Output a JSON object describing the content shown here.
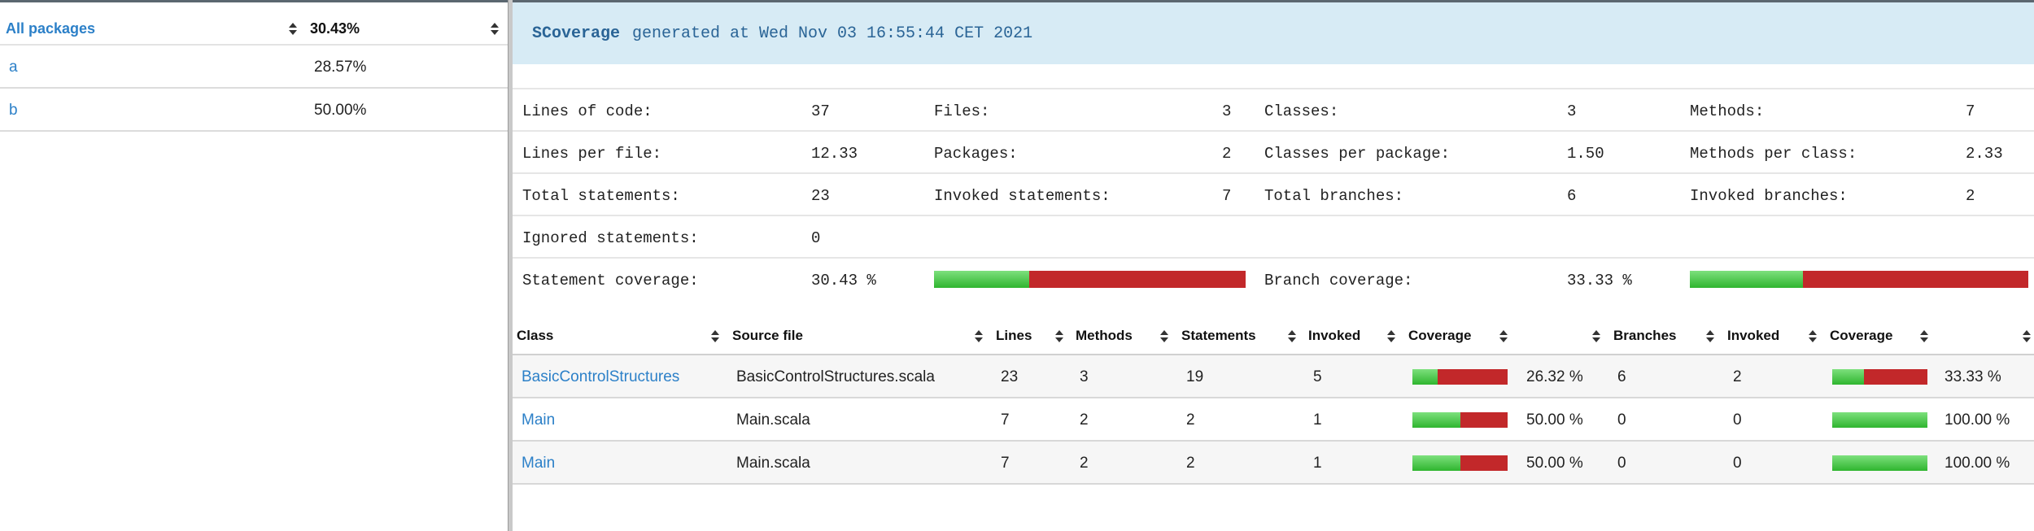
{
  "packages": {
    "header": {
      "name_label": "All packages",
      "coverage": "30.43%"
    },
    "items": [
      {
        "name": "a",
        "coverage": "28.57%"
      },
      {
        "name": "b",
        "coverage": "50.00%"
      }
    ]
  },
  "overview": {
    "brand": "SCoverage",
    "generated": "generated at Wed Nov 03 16:55:44 CET 2021",
    "lines_of_code_label": "Lines of code:",
    "lines_of_code": "37",
    "files_label": "Files:",
    "files": "3",
    "classes_label": "Classes:",
    "classes": "3",
    "methods_label": "Methods:",
    "methods": "7",
    "lines_per_file_label": "Lines per file:",
    "lines_per_file": "12.33",
    "packages_label": "Packages:",
    "packages": "2",
    "classes_per_package_label": "Classes per package:",
    "classes_per_package": "1.50",
    "methods_per_class_label": "Methods per class:",
    "methods_per_class": "2.33",
    "total_statements_label": "Total statements:",
    "total_statements": "23",
    "invoked_statements_label": "Invoked statements:",
    "invoked_statements": "7",
    "total_branches_label": "Total branches:",
    "total_branches": "6",
    "invoked_branches_label": "Invoked branches:",
    "invoked_branches": "2",
    "ignored_statements_label": "Ignored statements:",
    "ignored_statements": "0",
    "statement_coverage_label": "Statement coverage:",
    "statement_coverage": "30.43 %",
    "statement_coverage_fraction": 0.3043,
    "branch_coverage_label": "Branch coverage:",
    "branch_coverage": "33.33 %",
    "branch_coverage_fraction": 0.3333
  },
  "table": {
    "headers": [
      "Class",
      "Source file",
      "Lines",
      "Methods",
      "Statements",
      "Invoked",
      "Coverage",
      "",
      "Branches",
      "Invoked",
      "Coverage",
      ""
    ],
    "rows": [
      {
        "class": "BasicControlStructures",
        "source": "BasicControlStructures.scala",
        "lines": "23",
        "methods": "3",
        "statements": "19",
        "invoked": "5",
        "stmt_cov_fraction": 0.2632,
        "stmt_cov": "26.32 %",
        "branches": "6",
        "branch_invoked": "2",
        "branch_cov_fraction": 0.3333,
        "branch_cov": "33.33 %"
      },
      {
        "class": "Main",
        "source": "Main.scala",
        "lines": "7",
        "methods": "2",
        "statements": "2",
        "invoked": "1",
        "stmt_cov_fraction": 0.5,
        "stmt_cov": "50.00 %",
        "branches": "0",
        "branch_invoked": "0",
        "branch_cov_fraction": 1.0,
        "branch_cov": "100.00 %"
      },
      {
        "class": "Main",
        "source": "Main.scala",
        "lines": "7",
        "methods": "2",
        "statements": "2",
        "invoked": "1",
        "stmt_cov_fraction": 0.5,
        "stmt_cov": "50.00 %",
        "branches": "0",
        "branch_invoked": "0",
        "branch_cov_fraction": 1.0,
        "branch_cov": "100.00 %"
      }
    ]
  },
  "colors": {
    "link": "#2c80c8",
    "banner_bg": "#d7ebf5",
    "covered": "#3cbc3c",
    "uncovered": "#c2282a"
  }
}
